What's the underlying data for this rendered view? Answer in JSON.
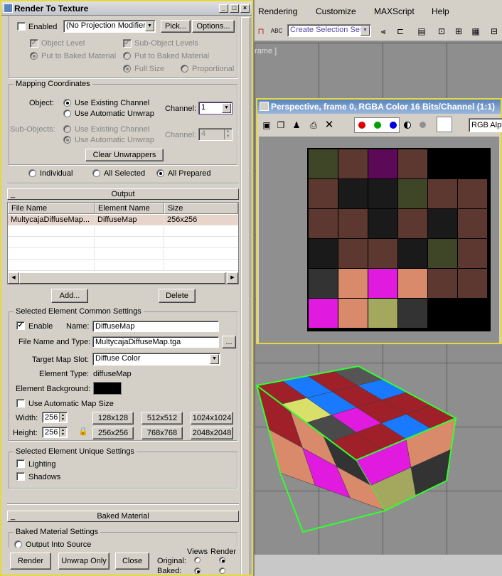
{
  "dialog": {
    "title": "Render To Texture",
    "title_buttons": [
      "_",
      "□",
      "×"
    ],
    "projection": {
      "enabled_label": "Enabled",
      "modifier_value": "(No Projection Modifier)",
      "pick_label": "Pick...",
      "options_label": "Options...",
      "object_level": "Object Level",
      "sub_object_levels": "Sub-Object Levels",
      "put_to_baked_1": "Put to Baked Material",
      "put_to_baked_2": "Put to Baked Material",
      "full_size": "Full Size",
      "proportional": "Proportional"
    },
    "mapping": {
      "title": "Mapping Coordinates",
      "object_label": "Object:",
      "use_existing": "Use Existing Channel",
      "use_automatic": "Use Automatic Unwrap",
      "channel_label": "Channel:",
      "channel_value": "1",
      "sub_objects_label": "Sub-Objects:",
      "sub_use_existing": "Use Existing Channel",
      "sub_use_automatic": "Use Automatic Unwrap",
      "sub_channel_label": "Channel:",
      "sub_channel_value": "4",
      "clear_unwrappers": "Clear Unwrappers"
    },
    "selection_mode": {
      "individual": "Individual",
      "all_selected": "All Selected",
      "all_prepared": "All Prepared"
    },
    "output": {
      "rollout_title": "Output",
      "rollout_sign": "_",
      "columns": [
        "File Name",
        "Element Name",
        "Size"
      ],
      "rows": [
        [
          "MultycajaDiffuseMap...",
          "DiffuseMap",
          "256x256"
        ]
      ],
      "add_label": "Add...",
      "delete_label": "Delete"
    },
    "common": {
      "title": "Selected Element Common Settings",
      "enable_label": "Enable",
      "name_label": "Name:",
      "name_value": "DiffuseMap",
      "file_label": "File Name and Type:",
      "file_value": "MultycajaDiffuseMap.tga",
      "browse_label": "...",
      "target_label": "Target Map Slot:",
      "target_value": "Diffuse Color",
      "element_type_label": "Element Type:",
      "element_type_value": "diffuseMap",
      "background_label": "Element Background:",
      "background_color": "#000000",
      "auto_size_label": "Use Automatic Map Size",
      "width_label": "Width:",
      "width_value": "256",
      "height_label": "Height:",
      "height_value": "256",
      "sizes": [
        "128x128",
        "512x512",
        "1024x1024",
        "256x256",
        "768x768",
        "2048x2048"
      ]
    },
    "unique": {
      "title": "Selected Element Unique Settings",
      "lighting": "Lighting",
      "shadows": "Shadows"
    },
    "baked": {
      "rollout_title": "Baked Material",
      "rollout_sign": "_",
      "settings_title": "Baked Material Settings",
      "output_into_source": "Output Into Source"
    },
    "footer": {
      "render": "Render",
      "unwrap_only": "Unwrap Only",
      "close": "Close",
      "views_label": "Views",
      "render_label": "Render",
      "original_label": "Original:",
      "baked_label": "Baked:"
    }
  },
  "max": {
    "menus": [
      "Rendering",
      "Customize",
      "MAXScript",
      "Help"
    ],
    "selection_set_placeholder": "Create Selection Set",
    "viewport_label": "rame ]"
  },
  "frame_window": {
    "title": "Perspective, frame 0, RGBA Color 16 Bits/Channel (1:1)",
    "channel_value": "RGB Alpha",
    "channel_colors": [
      "#e00000",
      "#00a000",
      "#0000e0"
    ]
  },
  "texture": {
    "cells": [
      [
        "#3f4628",
        "#5c3830",
        "#5c0a57",
        "#5c3830",
        "#000000",
        "#000000"
      ],
      [
        "#5c3830",
        "#1a1a1a",
        "#1a1a1a",
        "#3f4628",
        "#5c3830",
        "#5c3830"
      ],
      [
        "#5c3830",
        "#5c3830",
        "#1a1a1a",
        "#5c3830",
        "#1a1a1a",
        "#5c3830"
      ],
      [
        "#1a1a1a",
        "#5c3830",
        "#5c3830",
        "#1a1a1a",
        "#3f4628",
        "#5c3830"
      ],
      [
        "#333333",
        "#d98a6b",
        "#e01adf",
        "#d98a6b",
        "#5c3830",
        "#5c3830"
      ],
      [
        "#e01adf",
        "#d98a6b",
        "#a4a85e",
        "#333333",
        "#000000",
        "#000000"
      ]
    ]
  },
  "box_colors": {
    "top": [
      "#a0202a",
      "#1a7aff",
      "#a0202a",
      "#555555",
      "#d9e06a",
      "#1a7aff",
      "#a0202a",
      "#1a7aff",
      "#4a4a4a",
      "#e01adf",
      "#a0202a",
      "#a0202a",
      "#a0202a",
      "#a0202a",
      "#1a7aff",
      "#a0202a"
    ],
    "front": [
      "#a0202a",
      "#d98a6b",
      "#333333",
      "#d98a6b",
      "#e01adf",
      "#d98a6b"
    ],
    "side": [
      "#e01adf",
      "#d98a6b",
      "#a4a85e",
      "#333333"
    ]
  }
}
